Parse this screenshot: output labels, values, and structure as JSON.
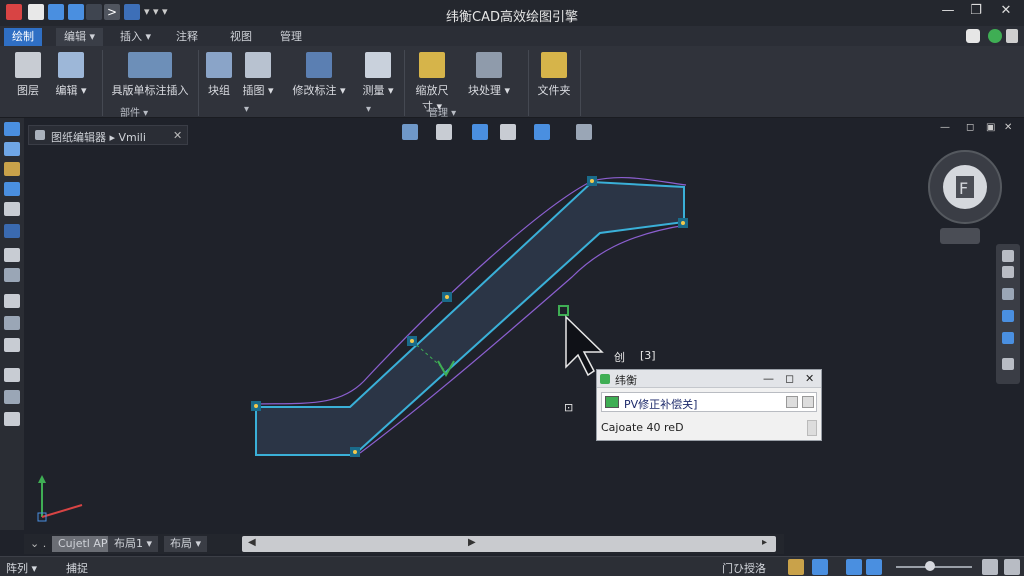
{
  "app": {
    "title": "纬衡CAD高效绘图引擎",
    "window_controls": [
      "—",
      "❐",
      "✕"
    ],
    "quick_access_more": "▾ ▾ ▾"
  },
  "tabs": [
    {
      "label": "绘制",
      "active": true
    },
    {
      "label": "编辑 ▾",
      "active": false
    },
    {
      "label": "插入 ▾",
      "active": false
    },
    {
      "label": "注释",
      "active": false
    },
    {
      "label": "视图",
      "active": false
    },
    {
      "label": "管理",
      "active": false
    }
  ],
  "ribbon": {
    "buttons": [
      {
        "label": "图层",
        "icon": "layer-icon"
      },
      {
        "label": "编辑 ▾",
        "icon": "edit-icon"
      },
      {
        "label": "具版单标注插入",
        "icon": "insert-block-icon"
      },
      {
        "label": "块组",
        "icon": "block-group-icon"
      },
      {
        "label": "插图 ▾",
        "icon": "image-icon"
      },
      {
        "label": "修改标注 ▾",
        "icon": "modify-dim-icon"
      },
      {
        "label": "测量 ▾",
        "icon": "measure-icon"
      },
      {
        "label": "缩放尺寸 ▾",
        "icon": "scale-icon"
      },
      {
        "label": "块处理 ▾",
        "icon": "block-tool-icon"
      },
      {
        "label": "文件夹",
        "icon": "folder-icon"
      }
    ],
    "panel_labels": [
      "部件 ▾",
      "▾",
      "▾",
      "管理 ▾"
    ]
  },
  "document": {
    "tab_label": "图纸编辑器 ▸ Vmili",
    "close": "✕"
  },
  "canvas": {
    "cursor_tip_left": "创",
    "cursor_tip_right": "[3]",
    "snap_marker": "⊡"
  },
  "palette": {
    "title": "纬衡",
    "controls": [
      "—",
      "◻",
      "✕"
    ],
    "input_value": "PV修正补偿关]",
    "status_text": "Cajoate 40 reD"
  },
  "layout_tabs": [
    {
      "label": "Cujetl AP"
    },
    {
      "label": "布局1 ▾"
    },
    {
      "label": "布局 ▾"
    }
  ],
  "status_bar": {
    "left": [
      "阵列 ▾",
      "捕捉"
    ],
    "right_label": "门ひ授洛",
    "zoom_level": 0.45
  },
  "accent": "#2f6fc4",
  "shape_stroke": "#3ab0d8",
  "shape_fill": "#2b3546",
  "grip_color": "#1a6b8a",
  "grip_dot": "#f2c94c"
}
